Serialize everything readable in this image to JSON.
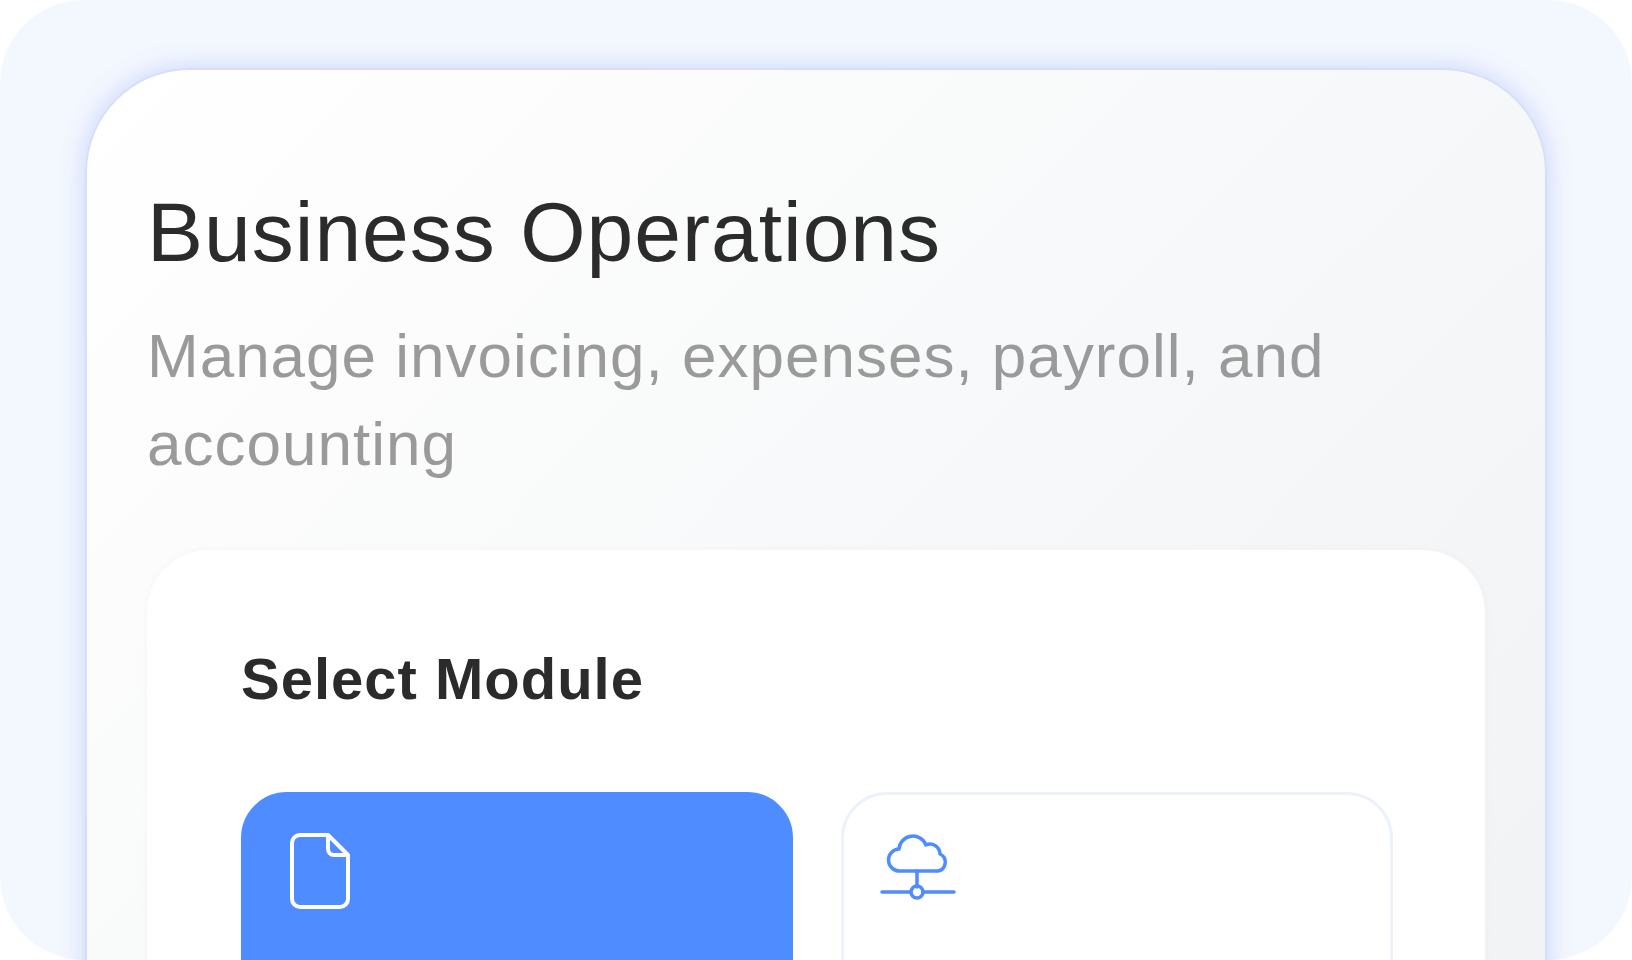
{
  "title": "Business Operations",
  "subtitle": "Manage invoicing, expenses, payroll, and accounting",
  "panel": {
    "heading": "Select Module",
    "modules": [
      {
        "selected": true
      },
      {
        "selected": false
      }
    ]
  }
}
